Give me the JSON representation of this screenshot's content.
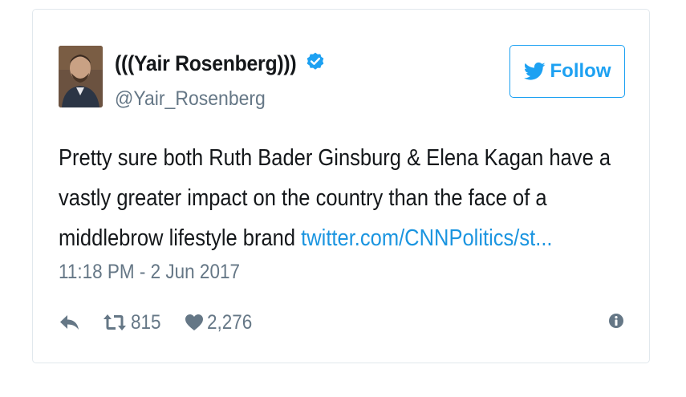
{
  "user": {
    "display_name": "(((Yair Rosenberg)))",
    "handle": "@Yair_Rosenberg",
    "verified": true
  },
  "follow_button": {
    "label": "Follow"
  },
  "tweet": {
    "lines": [
      "Pretty sure both Ruth Bader Ginsburg & Elena Kagan have a",
      "vastly greater impact on the country than the face of a",
      "middlebrow lifestyle brand "
    ],
    "link_text": "twitter.com/CNNPolitics/st...",
    "timestamp": "11:18 PM - 2 Jun 2017"
  },
  "actions": {
    "retweet_count": "815",
    "like_count": "2,276"
  },
  "colors": {
    "brand": "#1da1f2",
    "link": "#1b95e0",
    "muted": "#657786",
    "text": "#14171a",
    "border": "#e1e8ed"
  },
  "icons": [
    "avatar",
    "verified-badge-icon",
    "twitter-bird-icon",
    "reply-icon",
    "retweet-icon",
    "heart-icon",
    "info-icon"
  ]
}
